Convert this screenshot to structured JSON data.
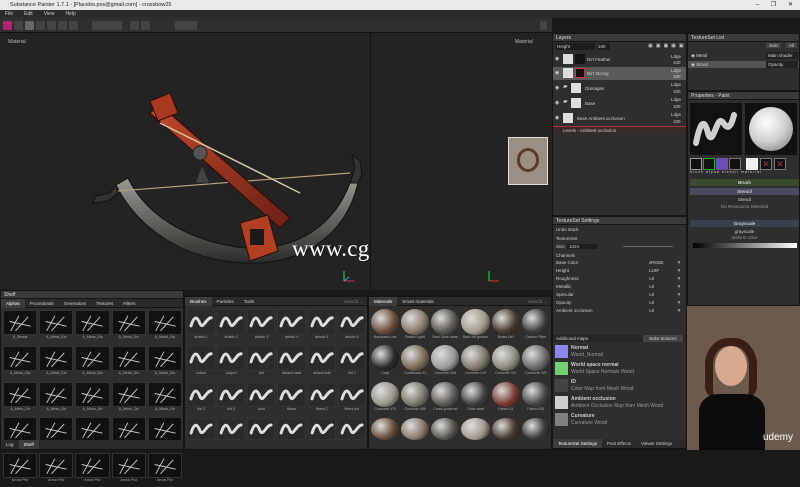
{
  "window": {
    "title": "Substance Painter 1.7.1 - [Placebo.pxs@gmail.com] - crossbow25",
    "controls": "–  ❐  ✕"
  },
  "menu": [
    "File",
    "Edit",
    "View",
    "Help"
  ],
  "viewport": {
    "left_label": "Material",
    "right_label": "Material",
    "watermark": "www.cg-ku.com"
  },
  "layers": {
    "title": "Layers",
    "blend": "Height",
    "opacity": "100",
    "items": [
      {
        "name": "Dirt Feather",
        "mode": "Ldge",
        "value": "100"
      },
      {
        "name": "Dirt Strong",
        "mode": "Ldge",
        "value": "100"
      },
      {
        "name": "Damages",
        "mode": "Ldge",
        "value": "100"
      },
      {
        "name": "Base",
        "mode": "Ldge",
        "value": "100"
      },
      {
        "name": "Base Ambient occlusion",
        "mode": "Ldge",
        "value": "100"
      }
    ],
    "effect": "Levels - Ambient occlusion"
  },
  "textureset_list": {
    "title": "TextureSet List",
    "solo": "Solo",
    "all": "All",
    "main_shader": "Main shader",
    "items": [
      {
        "name": "Metal",
        "shader": "Main shader"
      },
      {
        "name": "Wood",
        "shader": "Opacity"
      }
    ]
  },
  "properties": {
    "title": "Properties - Paint",
    "thumbs": [
      "brush",
      "alpha",
      "stencil",
      "material"
    ],
    "brush": "Brush",
    "stencil": "Stencil",
    "stencil_name": "Stencil",
    "stencil_status": "No Ressource Selected",
    "grayscale": "Grayscale",
    "grayscale_name": "grayscale",
    "grayscale_type": "uniform color"
  },
  "textureset_settings": {
    "title": "TextureSet Settings",
    "undo": "Undo stack",
    "textureset": "TextureSet",
    "size_label": "Size",
    "size_value": "1024",
    "channels_label": "Channels",
    "channels": [
      {
        "name": "Base Color",
        "format": "sRGB8",
        "fill": 0.9
      },
      {
        "name": "Height",
        "format": "L16F",
        "fill": 0.7
      },
      {
        "name": "Roughness",
        "format": "L8",
        "fill": 0.7
      },
      {
        "name": "Metallic",
        "format": "L8",
        "fill": 0.7
      },
      {
        "name": "Specular",
        "format": "L8",
        "fill": 0.7
      },
      {
        "name": "Opacity",
        "format": "L8",
        "fill": 0.7
      },
      {
        "name": "Ambient occlusion",
        "format": "L8",
        "fill": 0.7
      }
    ],
    "additional_maps": "Additional maps",
    "bake": "Bake textures",
    "maps": [
      {
        "title": "Normal",
        "sub": "Wood_Normal",
        "color": "#8b86f0"
      },
      {
        "title": "World space normal",
        "sub": "World Space Normals Wood",
        "color": "#6fd16f"
      },
      {
        "title": "ID",
        "sub": "Color Map from Mesh Wood",
        "color": "#444444"
      },
      {
        "title": "Ambient occlusion",
        "sub": "Ambient Occlusion Map from Mesh Wood",
        "color": "#cfcfcf"
      },
      {
        "title": "Curvature",
        "sub": "Curvature Wood",
        "color": "#808080"
      }
    ],
    "bottom_tabs": [
      "TextureSet Settings",
      "Post Effects",
      "Viewer Settings"
    ]
  },
  "shelf": {
    "title": "Shelf",
    "tabs": [
      "Alphas",
      "Procedurals",
      "Generators",
      "Textures",
      "Filters"
    ],
    "alphas": [
      "A_Beads",
      "A_Metal_Dis",
      "A_Metal_Dis",
      "A_Metal_Dis",
      "A_Metal_Dis",
      "A_Metal_Dis",
      "A_Metal_Dis",
      "A_Metal_Dis",
      "A_Metal_Dis",
      "A_Metal_Dis",
      "A_Mesh_Dir",
      "A_Mesh_Dir",
      "A_Mesh_Dir",
      "A_Mesh_Dir",
      "A_Mesh_Dir",
      "A_Metal_Dir",
      "A_Metal_Dir",
      "A_Metal_Dir",
      "A_Metal_Dir",
      "Alpha Crack",
      "Arrow Pict",
      "Arrow Pict",
      "Arrow Pict",
      "Arrow Pict",
      "Arrow Pict"
    ],
    "bottom_tabs": [
      "Log",
      "Shelf"
    ]
  },
  "brushes": {
    "tabs": [
      "Brushes",
      "Particles",
      "Tools"
    ],
    "search": "Search...",
    "items": [
      "artistic 1",
      "artistic 2",
      "artistic 3",
      "artistic 4",
      "artistic 5",
      "artistic 6",
      "cotton",
      "crayon",
      "dirt",
      "default hard",
      "default soft",
      "dirt 1",
      "dirt 2",
      "dirt 3",
      "dust",
      "fibers",
      "fibers 2",
      "fibers hm",
      "",
      "",
      "",
      "",
      "",
      ""
    ]
  },
  "materials": {
    "tabs": [
      "Materials",
      "Smart materials"
    ],
    "search": "Search...",
    "items": [
      "Backpack Lea",
      "Baked Lighti",
      "Bark Gear clean",
      "Bark old grease",
      "Brass Dirt",
      "Carbon Fiber",
      "Coal",
      "Cardboard 01",
      "Concrete 006",
      "Concrete 010",
      "Concrete 011",
      "Concrete 020",
      "Concrete 070",
      "Concrete 050",
      "Cross-ponymer",
      "Color steel",
      "Fabric 03",
      "Fabric 033",
      "",
      "",
      "",
      "",
      "",
      ""
    ]
  },
  "udemy": "udemy"
}
